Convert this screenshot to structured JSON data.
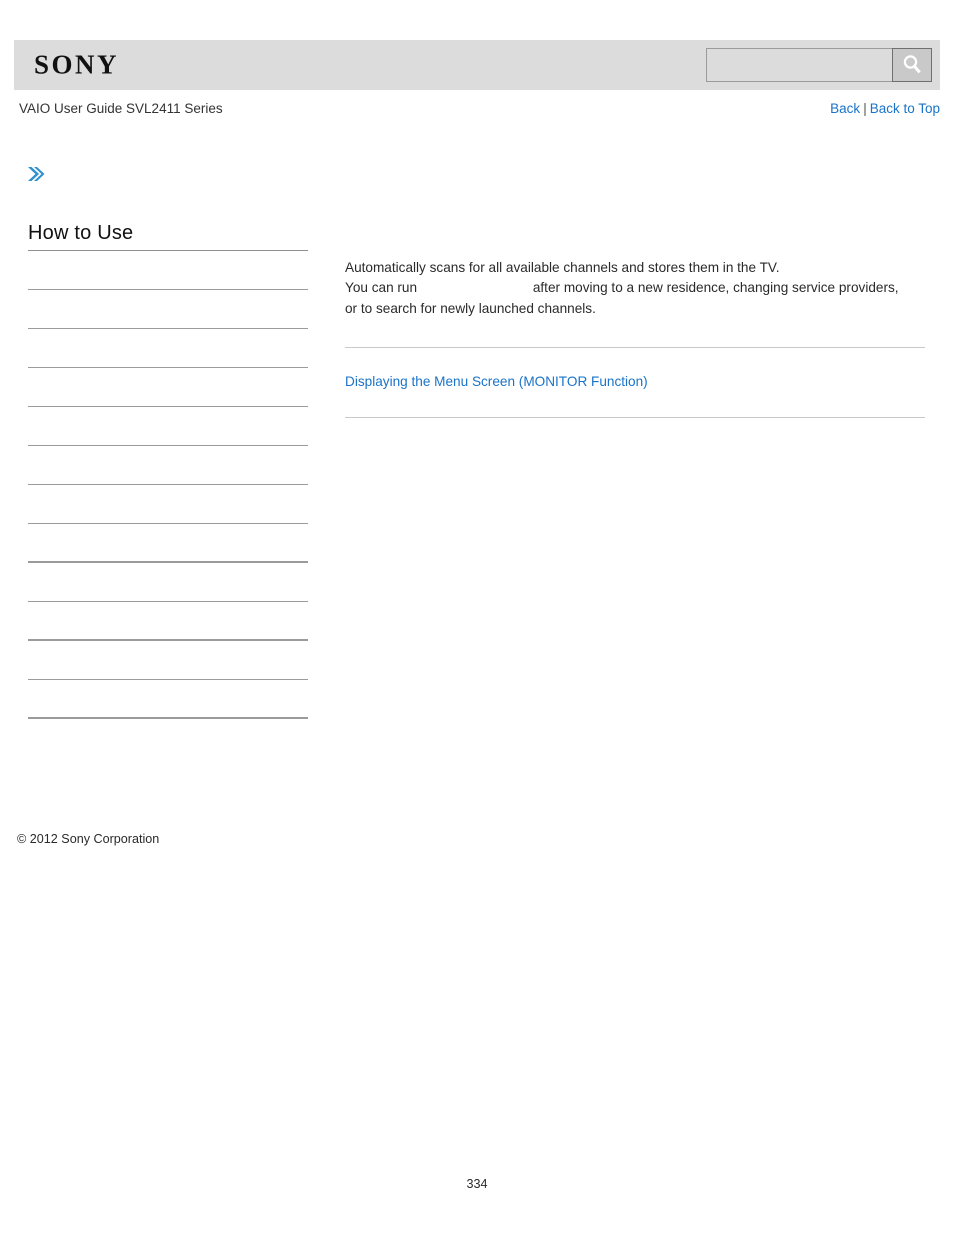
{
  "header": {
    "logo_text": "SONY",
    "search": {
      "value": "",
      "placeholder": "",
      "button_icon": "search-icon"
    }
  },
  "breadcrumb": {
    "title": "VAIO User Guide SVL2411 Series",
    "back_label": "Back",
    "separator": "|",
    "back_to_top_label": "Back to Top"
  },
  "marker": {
    "icon": "chevron-double-right-icon"
  },
  "sidebar": {
    "heading": "How to Use",
    "items": [
      {
        "label": ""
      },
      {
        "label": ""
      },
      {
        "label": ""
      },
      {
        "label": ""
      },
      {
        "label": ""
      },
      {
        "label": ""
      },
      {
        "label": ""
      },
      {
        "label": ""
      },
      {
        "label": ""
      },
      {
        "label": ""
      },
      {
        "label": ""
      },
      {
        "label": ""
      }
    ]
  },
  "main": {
    "paragraph_line_1": "Automatically scans for all available channels and stores them in the TV.",
    "paragraph_line_2_before": "You can run",
    "paragraph_line_2_after": "after moving to a new residence, changing service providers,",
    "paragraph_line_3": "or to search for newly launched channels.",
    "related_link": "Displaying the Menu Screen (MONITOR Function)"
  },
  "footer": {
    "copyright": "© 2012 Sony Corporation",
    "page_number": "334"
  },
  "colors": {
    "header_bg": "#dcdcdc",
    "link_blue": "#1a73c8",
    "rule_gray": "#9b9b9b",
    "content_rule_gray": "#c9c9c9",
    "text": "#2a2a2a"
  }
}
